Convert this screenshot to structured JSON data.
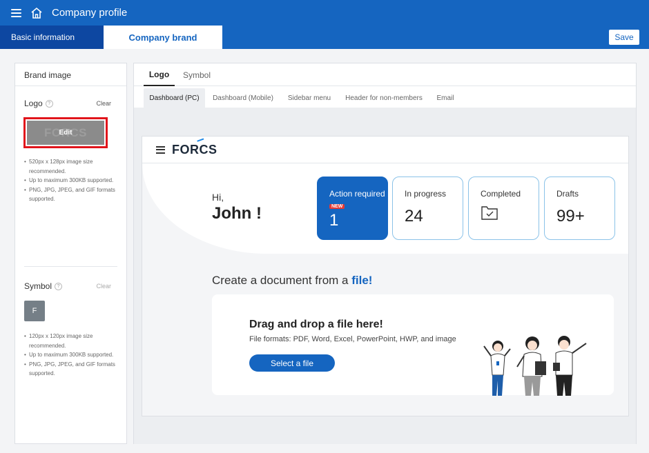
{
  "app": {
    "title": "Company profile"
  },
  "tabs": {
    "basic": "Basic information",
    "brand": "Company brand",
    "save": "Save"
  },
  "left": {
    "title": "Brand image",
    "logo": {
      "label": "Logo",
      "clear": "Clear",
      "edit": "Edit",
      "preview_text": "FORCS",
      "notes": [
        "520px x 128px image size recommended.",
        "Up to maximum 300KB supported.",
        "PNG, JPG, JPEG, and GIF formats supported."
      ]
    },
    "symbol": {
      "label": "Symbol",
      "clear": "Clear",
      "letter": "F",
      "notes": [
        "120px x 120px image size recommended.",
        "Up to maximum 300KB supported.",
        "PNG, JPG, JPEG, and GIF formats supported."
      ]
    },
    "help": "?"
  },
  "right": {
    "main_tabs": [
      "Logo",
      "Symbol"
    ],
    "sub_tabs": [
      "Dashboard (PC)",
      "Dashboard (Mobile)",
      "Sidebar menu",
      "Header for non-members",
      "Email"
    ],
    "preview": {
      "logo_text": "FORCS",
      "greeting_hi": "Hi,",
      "greeting_name": "John !",
      "stats": [
        {
          "label": "Action required",
          "badge": "NEW",
          "value": "1"
        },
        {
          "label": "In progress",
          "value": "24"
        },
        {
          "label": "Completed"
        },
        {
          "label": "Drafts",
          "value": "99+"
        }
      ],
      "create_prefix": "Create a document from a ",
      "create_highlight": "file!",
      "drop_title": "Drag and drop a file here!",
      "drop_formats": "File formats: PDF, Word, Excel, PowerPoint, HWP, and image",
      "select_button": "Select a file"
    }
  },
  "colors": {
    "brand": "#1565c0",
    "brand_dark": "#0d47a1",
    "alert": "#e1141b"
  }
}
